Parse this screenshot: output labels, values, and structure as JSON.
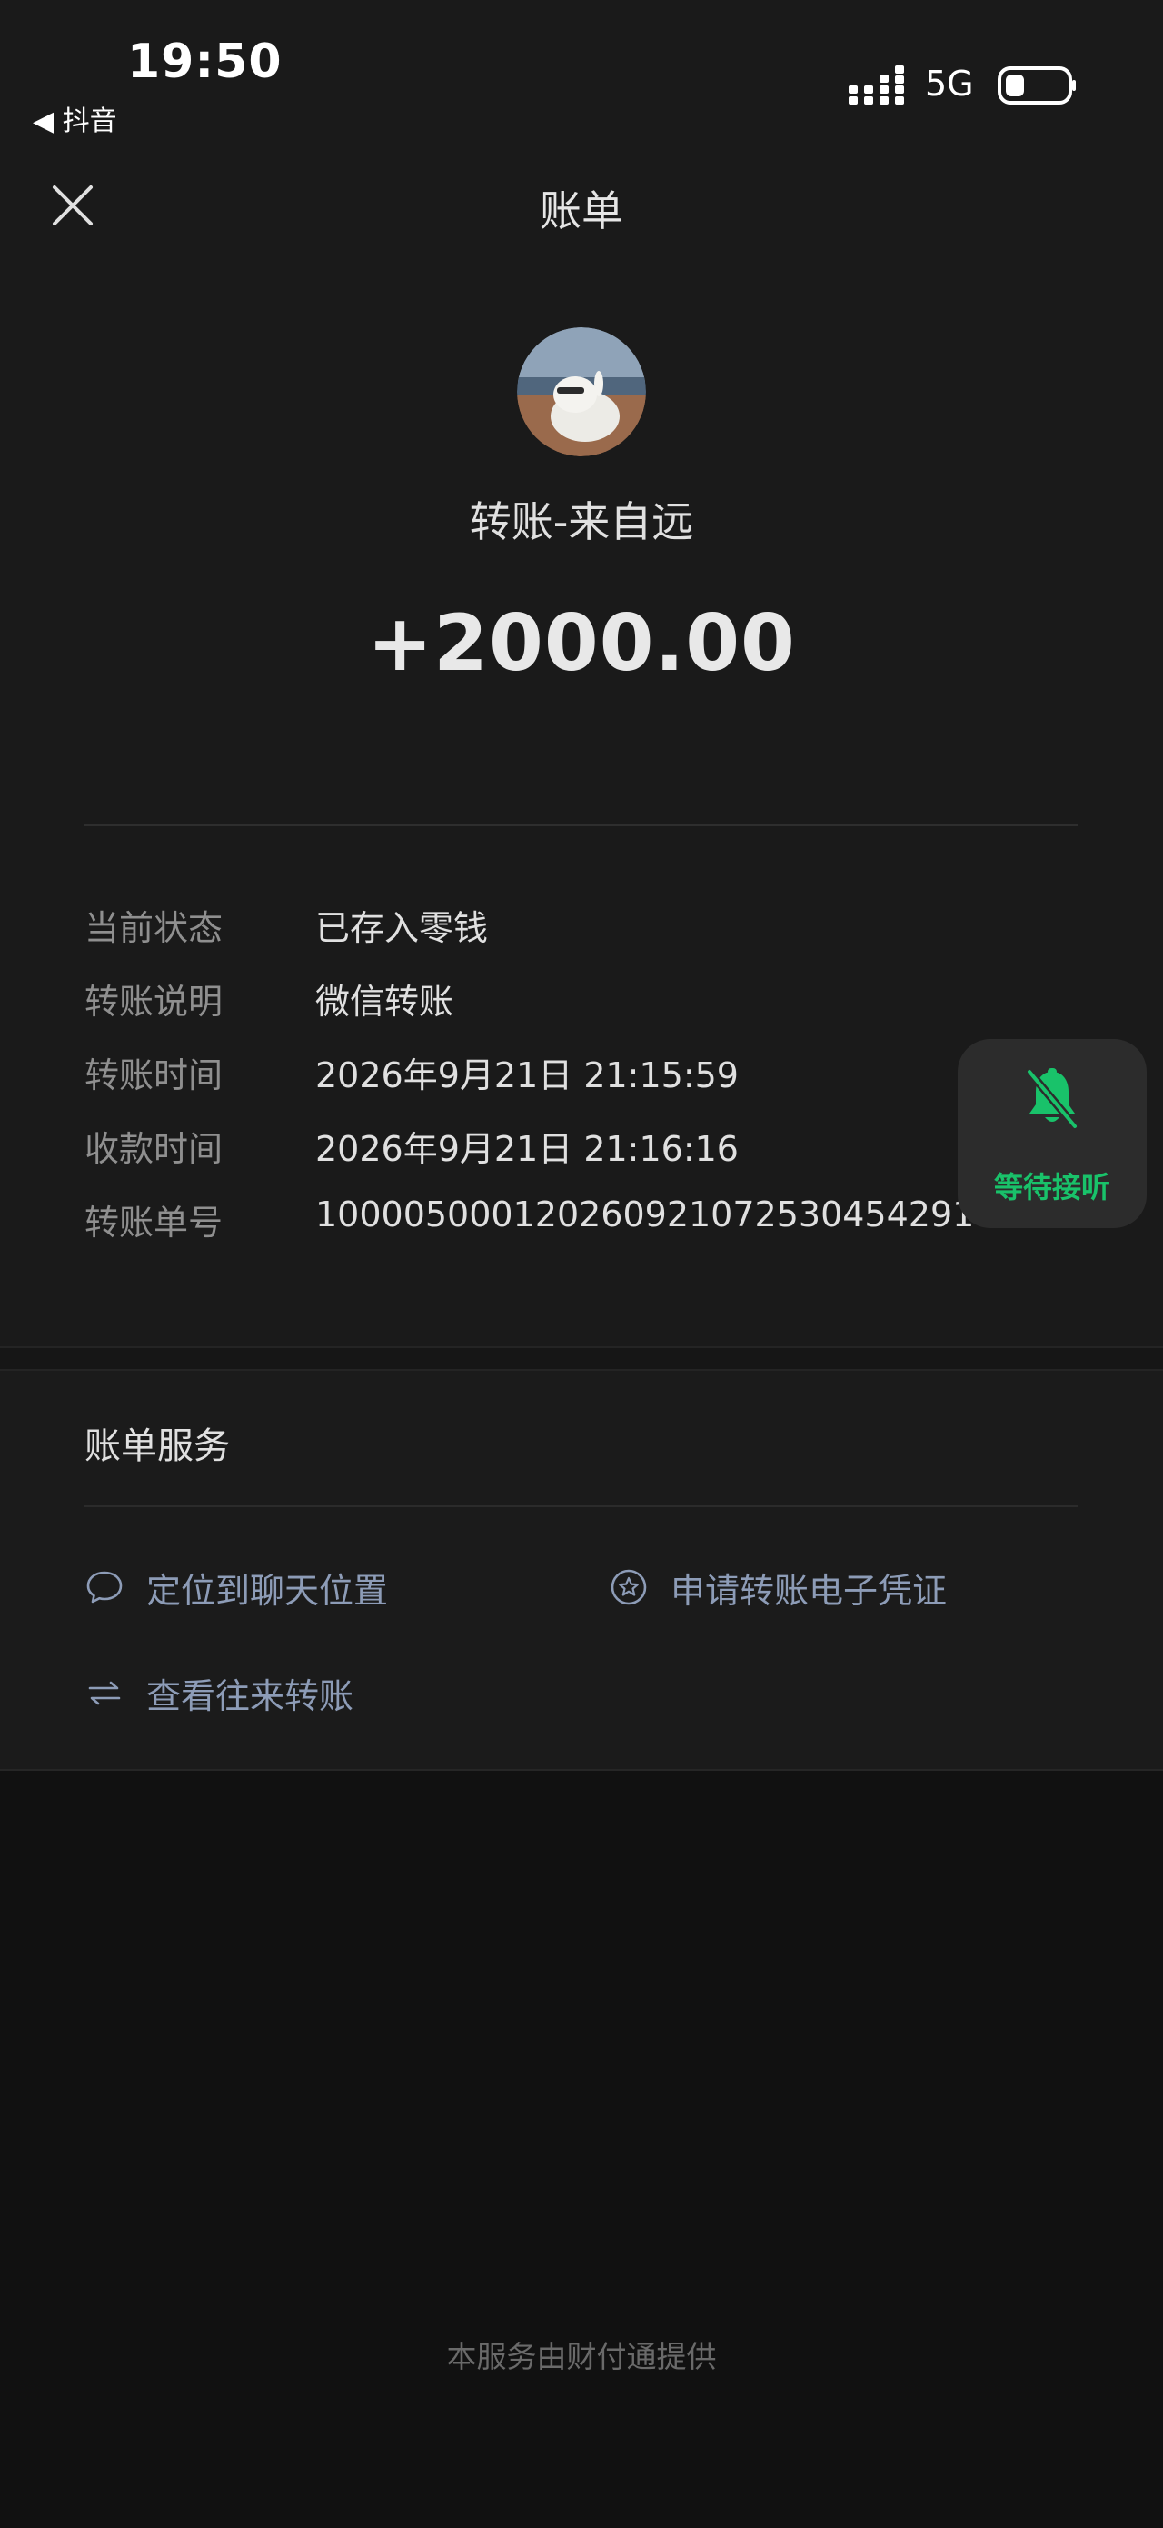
{
  "status_bar": {
    "time": "19:50",
    "back_app": "◀ 抖音",
    "network": "5G"
  },
  "header": {
    "title": "账单"
  },
  "transaction": {
    "payer": "转账-来自远",
    "amount": "+2000.00"
  },
  "details": [
    {
      "label": "当前状态",
      "value": "已存入零钱"
    },
    {
      "label": "转账说明",
      "value": "微信转账"
    },
    {
      "label": "转账时间",
      "value": "2026年9月21日 21:15:59"
    },
    {
      "label": "收款时间",
      "value": "2026年9月21日 21:16:16"
    },
    {
      "label": "转账单号",
      "value": "1000050001202609210725304542917"
    }
  ],
  "floating_call": {
    "label": "等待接听",
    "color": "#19c26a"
  },
  "services": {
    "title": "账单服务",
    "locate_chat": "定位到聊天位置",
    "apply_voucher": "申请转账电子凭证",
    "view_transfers": "查看往来转账"
  },
  "footer": "本服务由财付通提供",
  "colors": {
    "accent_link": "#8d9cb7",
    "background": "#1a1a1a"
  }
}
